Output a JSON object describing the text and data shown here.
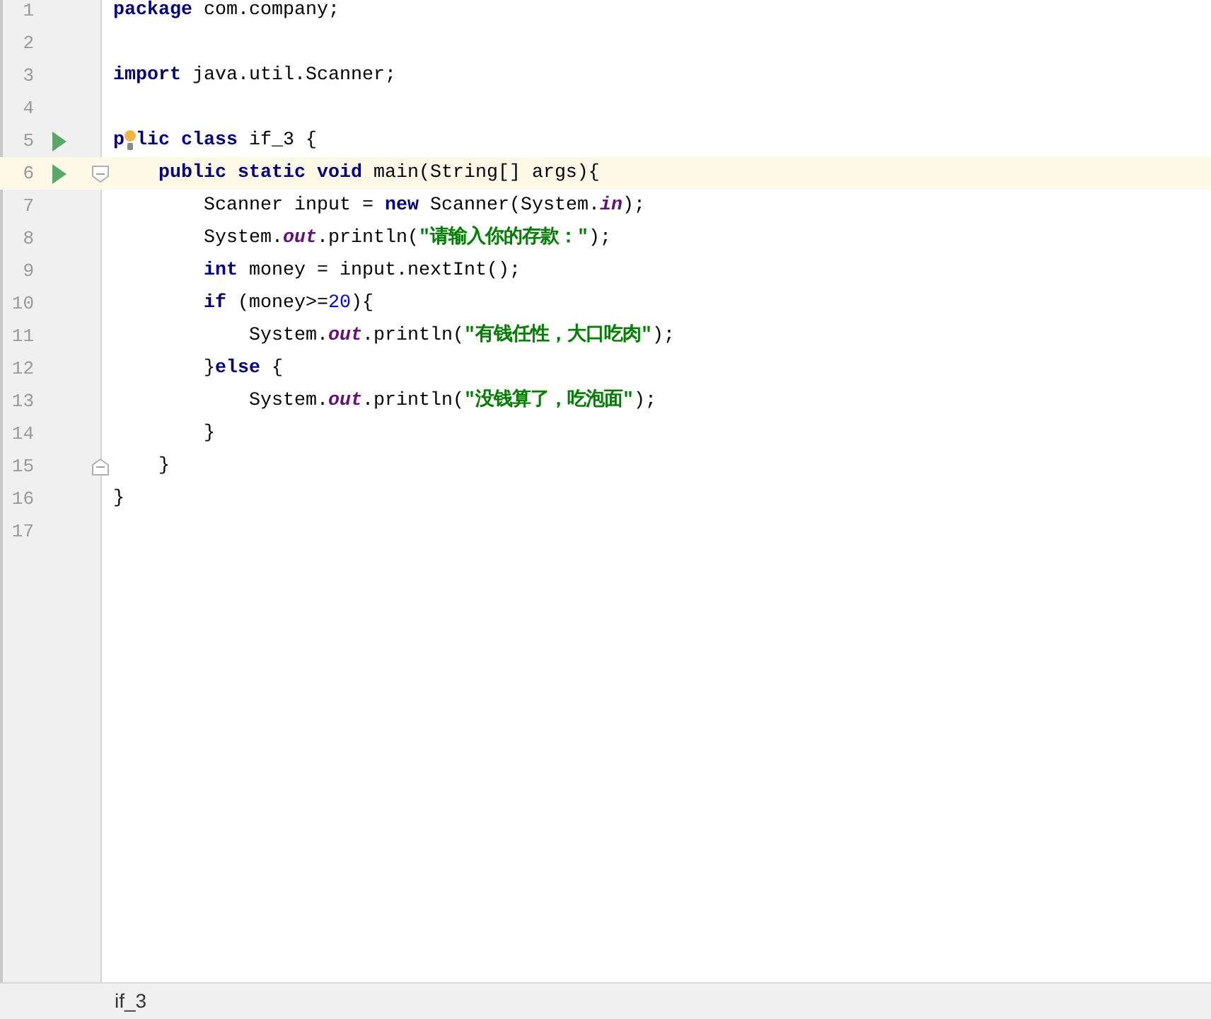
{
  "editor": {
    "lines": [
      {
        "number": "1",
        "kind": "plain",
        "run": false,
        "current": false,
        "tokens": [
          {
            "kind": "keyword",
            "text": "package"
          },
          {
            "kind": "plain",
            "text": " com.company;"
          }
        ]
      },
      {
        "number": "2",
        "kind": "plain",
        "run": false,
        "current": false
      },
      {
        "number": "3",
        "kind": "plain",
        "run": false,
        "current": false,
        "tokens": [
          {
            "kind": "keyword",
            "text": "import"
          },
          {
            "kind": "plain",
            "text": " java.util.Scanner;"
          }
        ]
      },
      {
        "number": "4",
        "kind": "plain",
        "run": false,
        "current": false
      },
      {
        "number": "5",
        "kind": "plain",
        "run": true,
        "current": false,
        "tokens": [
          {
            "kind": "keyword",
            "text": "p"
          },
          {
            "kind": "bulb"
          },
          {
            "kind": "keyword",
            "text": "lic class"
          },
          {
            "kind": "plain",
            "text": " if_3 {"
          }
        ]
      },
      {
        "number": "6",
        "kind": "fold_start",
        "run": true,
        "current": true,
        "tokens": [
          {
            "kind": "keyword",
            "text": "    public static void"
          },
          {
            "kind": "plain",
            "text": " main(String[] args){"
          }
        ]
      },
      {
        "number": "7",
        "kind": "plain",
        "run": false,
        "current": false,
        "tokens": [
          {
            "kind": "plain",
            "text": "        Scanner input = "
          },
          {
            "kind": "keyword",
            "text": "new"
          },
          {
            "kind": "plain",
            "text": " Scanner(System."
          },
          {
            "kind": "field",
            "text": "in"
          },
          {
            "kind": "plain",
            "text": ");"
          }
        ]
      },
      {
        "number": "8",
        "kind": "plain",
        "run": false,
        "current": false,
        "tokens": [
          {
            "kind": "plain",
            "text": "        System."
          },
          {
            "kind": "field",
            "text": "out"
          },
          {
            "kind": "plain",
            "text": ".println("
          },
          {
            "kind": "string",
            "text": "\"请输入你的存款：\""
          },
          {
            "kind": "plain",
            "text": ");"
          }
        ]
      },
      {
        "number": "9",
        "kind": "plain",
        "run": false,
        "current": false,
        "tokens": [
          {
            "kind": "keyword",
            "text": "        int"
          },
          {
            "kind": "plain",
            "text": " money = input.nextInt();"
          }
        ]
      },
      {
        "number": "10",
        "kind": "plain",
        "run": false,
        "current": false,
        "tokens": [
          {
            "kind": "keyword",
            "text": "        if"
          },
          {
            "kind": "plain",
            "text": " (money>="
          },
          {
            "kind": "number",
            "text": "20"
          },
          {
            "kind": "plain",
            "text": "){"
          }
        ]
      },
      {
        "number": "11",
        "kind": "plain",
        "run": false,
        "current": false,
        "tokens": [
          {
            "kind": "plain",
            "text": "            System."
          },
          {
            "kind": "field",
            "text": "out"
          },
          {
            "kind": "plain",
            "text": ".println("
          },
          {
            "kind": "string",
            "text": "\"有钱任性，大口吃肉\""
          },
          {
            "kind": "plain",
            "text": ");"
          }
        ]
      },
      {
        "number": "12",
        "kind": "plain",
        "run": false,
        "current": false,
        "tokens": [
          {
            "kind": "plain",
            "text": "        }"
          },
          {
            "kind": "keyword",
            "text": "else"
          },
          {
            "kind": "plain",
            "text": " {"
          }
        ]
      },
      {
        "number": "13",
        "kind": "plain",
        "run": false,
        "current": false,
        "tokens": [
          {
            "kind": "plain",
            "text": "            System."
          },
          {
            "kind": "field",
            "text": "out"
          },
          {
            "kind": "plain",
            "text": ".println("
          },
          {
            "kind": "string",
            "text": "\"没钱算了，吃泡面\""
          },
          {
            "kind": "plain",
            "text": ");"
          }
        ]
      },
      {
        "number": "14",
        "kind": "plain",
        "run": false,
        "current": false,
        "tokens": [
          {
            "kind": "plain",
            "text": "        }"
          }
        ]
      },
      {
        "number": "15",
        "kind": "fold_end",
        "run": false,
        "current": false,
        "tokens": [
          {
            "kind": "plain",
            "text": "    }"
          }
        ]
      },
      {
        "number": "16",
        "kind": "plain",
        "run": false,
        "current": false,
        "tokens": [
          {
            "kind": "plain",
            "text": "}"
          }
        ]
      },
      {
        "number": "17",
        "kind": "plain",
        "run": false,
        "current": false
      }
    ]
  },
  "status_bar": {
    "breadcrumb": "if_3"
  }
}
